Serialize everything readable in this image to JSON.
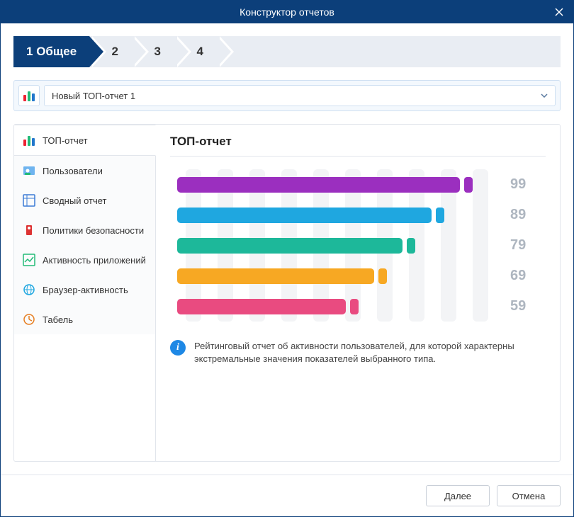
{
  "window": {
    "title": "Конструктор отчетов"
  },
  "steps": [
    {
      "num": "1",
      "label": "Общее",
      "active": true
    },
    {
      "num": "2",
      "label": "",
      "active": false
    },
    {
      "num": "3",
      "label": "",
      "active": false
    },
    {
      "num": "4",
      "label": "",
      "active": false
    }
  ],
  "report_selector": {
    "value": "Новый ТОП-отчет 1"
  },
  "sidebar": {
    "items": [
      {
        "id": "top-report",
        "label": "ТОП-отчет",
        "selected": true
      },
      {
        "id": "users",
        "label": "Пользователи",
        "selected": false
      },
      {
        "id": "summary",
        "label": "Сводный отчет",
        "selected": false
      },
      {
        "id": "security",
        "label": "Политики безопасности",
        "selected": false
      },
      {
        "id": "app-activity",
        "label": "Активность приложений",
        "selected": false
      },
      {
        "id": "browser-activity",
        "label": "Браузер-активность",
        "selected": false
      },
      {
        "id": "timesheet",
        "label": "Табель",
        "selected": false
      }
    ]
  },
  "detail": {
    "title": "ТОП-отчет",
    "description": "Рейтинговый отчет об активности пользователей, для которой характерны экстремальные значения показателей выбранного типа."
  },
  "chart_data": {
    "type": "bar",
    "orientation": "horizontal",
    "values": [
      99,
      89,
      79,
      69,
      59
    ],
    "colors": [
      "#9b2fbf",
      "#1fa7e0",
      "#1db89a",
      "#f7a823",
      "#e94b80"
    ],
    "xlim": [
      0,
      100
    ],
    "title": "",
    "xlabel": "",
    "ylabel": ""
  },
  "footer": {
    "next": "Далее",
    "cancel": "Отмена"
  }
}
